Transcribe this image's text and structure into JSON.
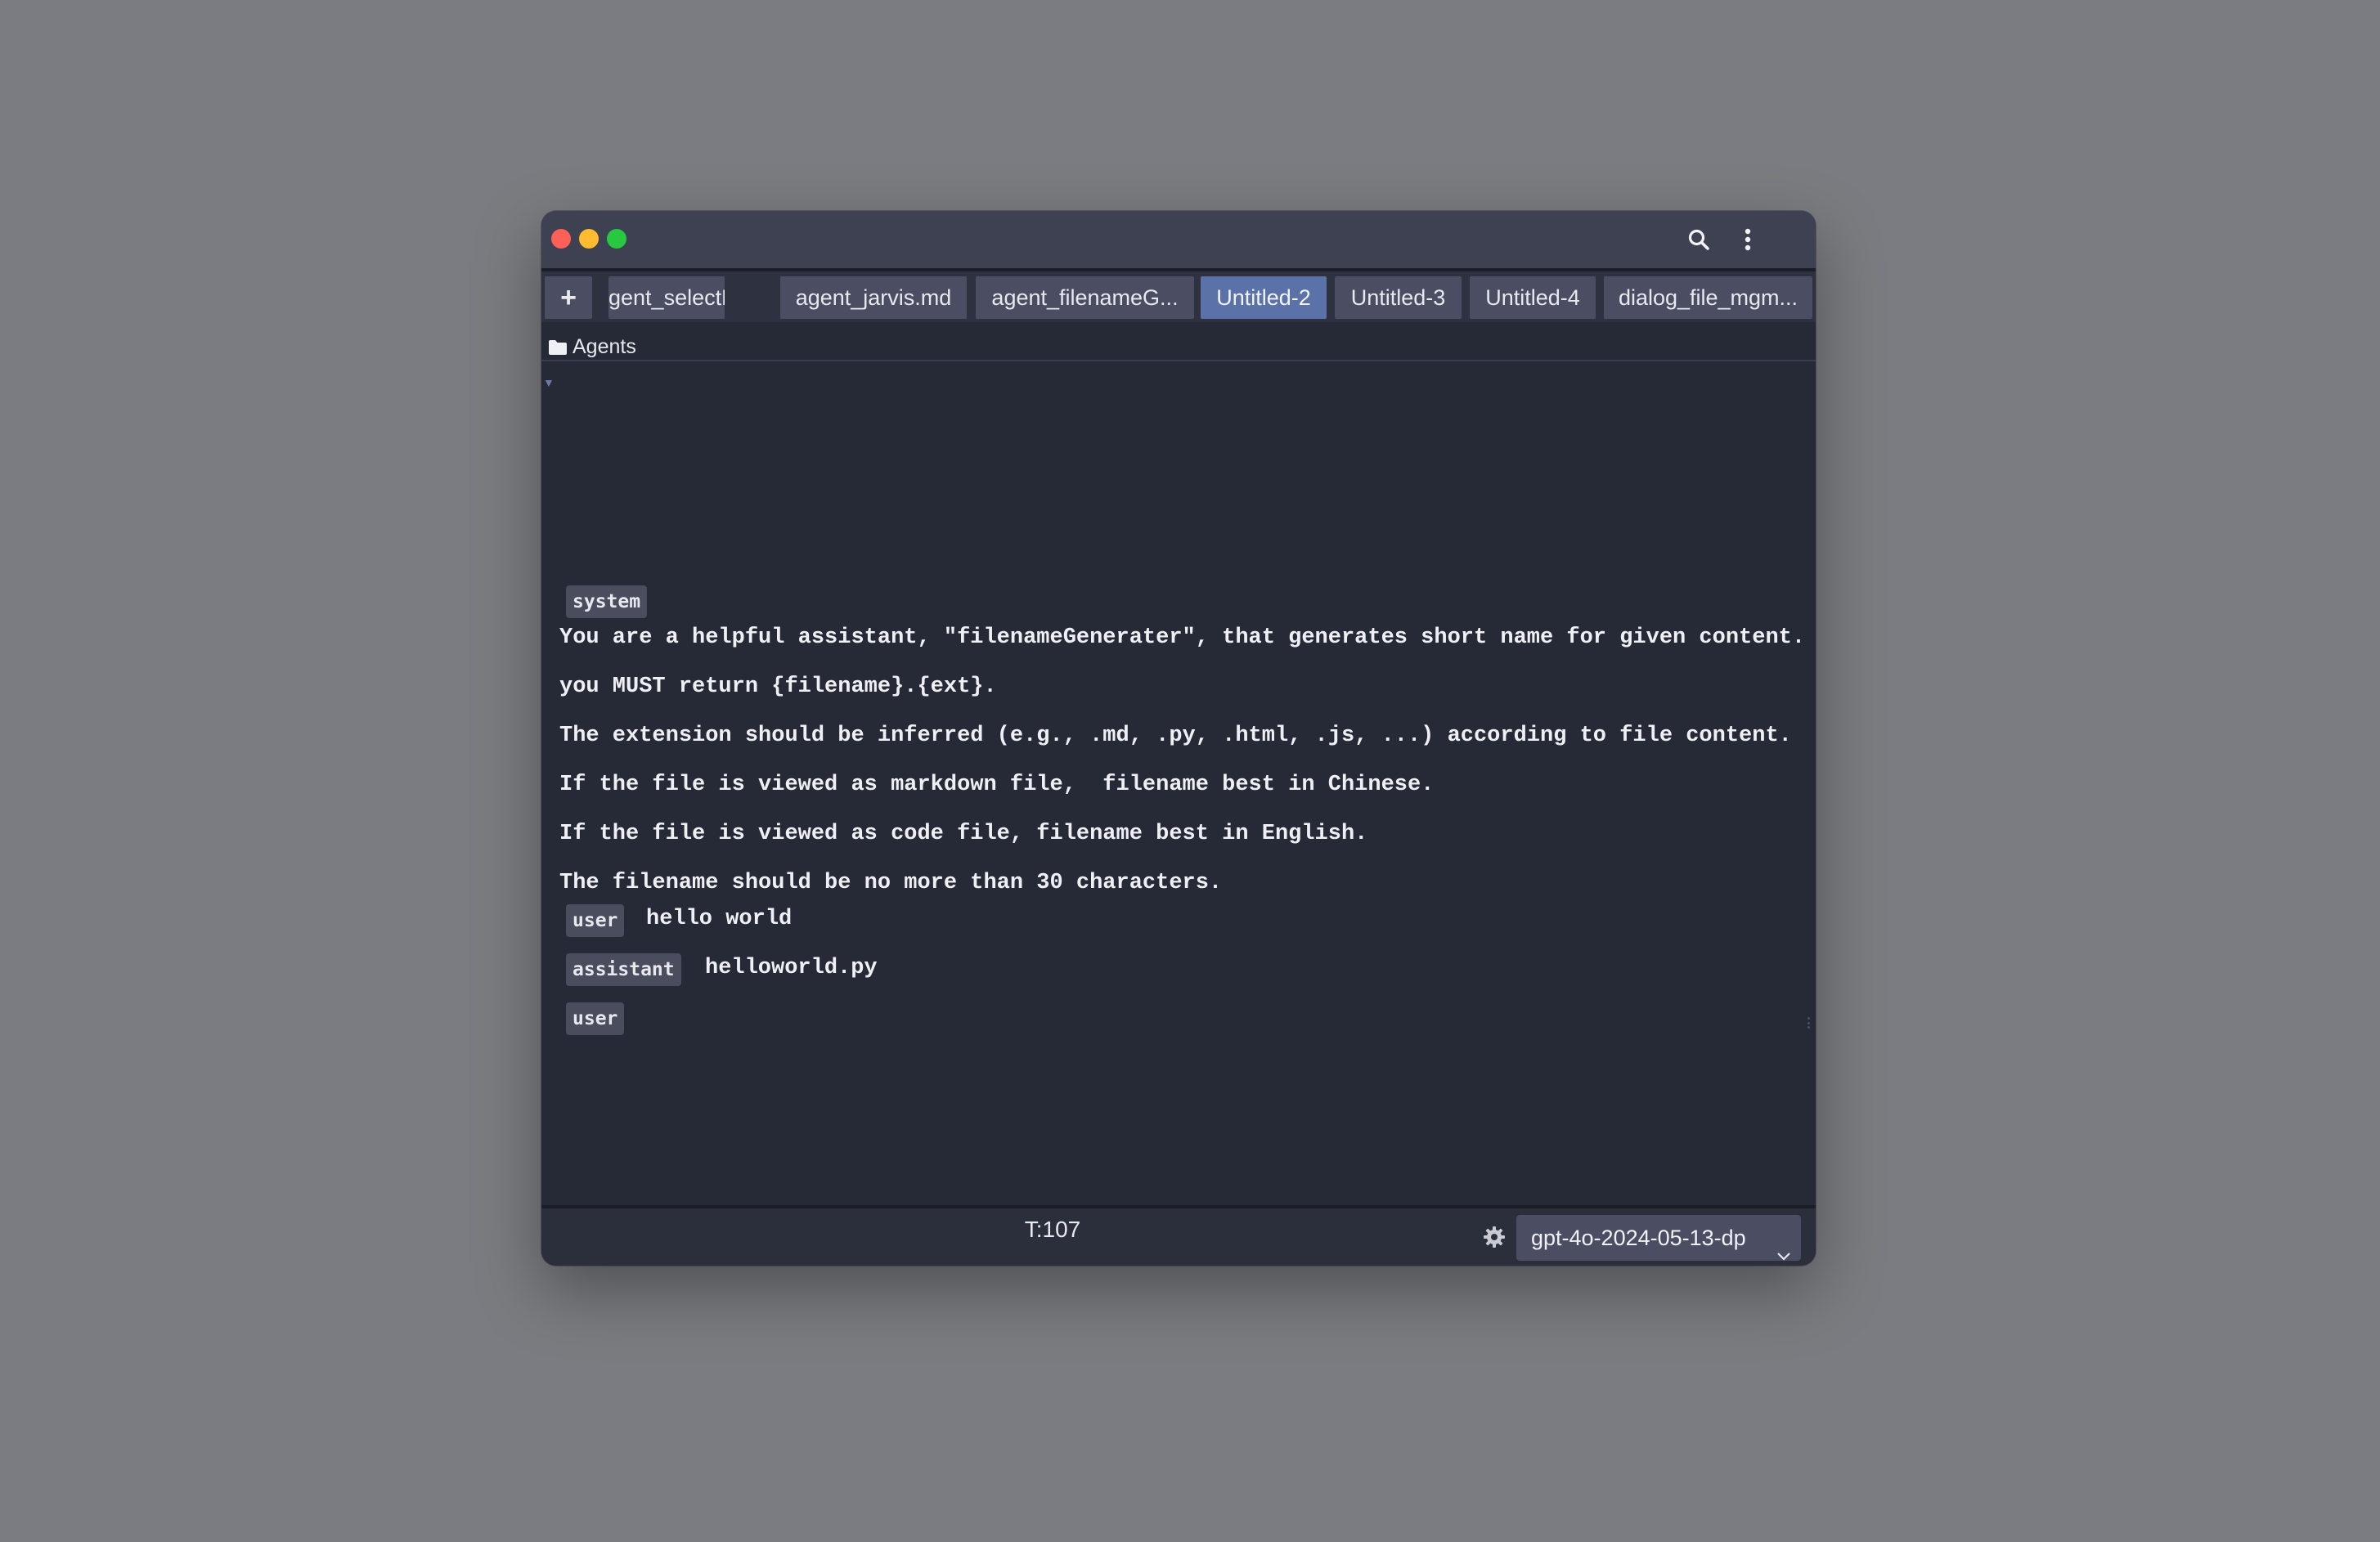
{
  "window": {
    "controls": [
      "close",
      "minimize",
      "maximize"
    ]
  },
  "titlebar": {
    "search_icon": "search-icon",
    "menu_icon": "more-vertical-icon"
  },
  "tabs": {
    "add_label": "+",
    "items": [
      {
        "label": "gent_selectFil..."
      },
      {
        "label": "agent_jarvis.md"
      },
      {
        "label": "agent_filenameG..."
      },
      {
        "label": "Untitled-2",
        "active": true
      },
      {
        "label": "Untitled-3"
      },
      {
        "label": "Untitled-4"
      },
      {
        "label": "dialog_file_mgm..."
      }
    ]
  },
  "breadcrumb": {
    "icon": "folder-icon",
    "label": "Agents"
  },
  "conversation": {
    "system": {
      "role": "system",
      "lines": [
        "You are a helpful assistant, \"filenameGenerater\", that generates short name for given content.",
        "you MUST return {filename}.{ext}.",
        "The extension should be inferred (e.g., .md, .py, .html, .js, ...) according to file content.",
        "If the file is viewed as markdown file,  filename best in Chinese.",
        "If the file is viewed as code file, filename best in English.",
        "The filename should be no more than 30 characters."
      ]
    },
    "messages": [
      {
        "role": "user",
        "text": "hello world"
      },
      {
        "role": "assistant",
        "text": "helloworld.py"
      },
      {
        "role": "user",
        "text": ""
      }
    ]
  },
  "footer": {
    "token_count": "T:107",
    "settings_icon": "gear-icon",
    "model": "gpt-4o-2024-05-13-dp"
  },
  "colors": {
    "background": "#7b7c81",
    "window": "#262936",
    "titlebar": "#3e4152",
    "tab": "#4b4e62",
    "tab_active": "#5b72a8",
    "role_badge": "#4a4d5e"
  }
}
